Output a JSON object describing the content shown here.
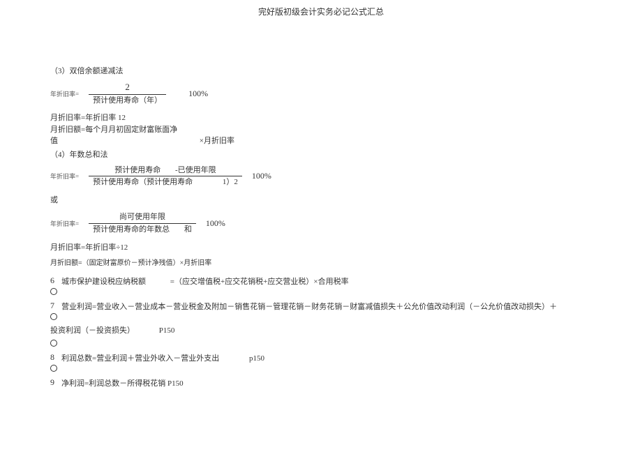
{
  "title": "完好版初级会计实务必记公式汇总",
  "sections": {
    "s3_head": "（3）双倍余额递减法",
    "s3_formula_label": "年折旧率=",
    "s3_num": "2",
    "s3_den": "预计使用寿命（年）",
    "s3_pct": "100%",
    "s3_line1": "月折旧率=年折旧率 12",
    "s3_line2a": "月折旧额=每个月月初固定财富账面净",
    "s3_line2b": "值",
    "s3_line2c": "×月折旧率",
    "s4_head": "（4）年数总和法",
    "s4_formula_label": "年折旧率=",
    "s4a_num_left": "预计使用寿命",
    "s4a_num_right": "-已使用年限",
    "s4a_den_left": "预计使用寿命（预计使用寿命",
    "s4a_den_right": "1）2",
    "s4a_pct": "100%",
    "or_word": "或",
    "s4b_label": "年折旧率=",
    "s4b_num": "尚可使用年限",
    "s4b_den_left": "预计使用寿命的年数总",
    "s4b_den_right": "和",
    "s4b_pct": "100%",
    "s4_line1": "月折旧率=年折旧率÷12",
    "s4_line2": "月折旧额=（固定财富原价－预计净残值）×月折旧率",
    "n6_num": "6",
    "n6_text_a": "城市保护建设税应纳税额",
    "n6_text_b": "=（应交增值税+应交花销税+应交营业税）×合用税率",
    "n7_num": "7",
    "n7_text": "营业利润=营业收入－营业成本－营业税金及附加－销售花销－管理花销－财务花销－财富减值损失＋公允价值改动利润（－公允价值改动损失）＋",
    "n7_text2_a": "投资利润（－投资损失）",
    "n7_text2_b": "P150",
    "n8_num": "8",
    "n8_text_a": "利润总数=营业利润＋营业外收入－营业外支出",
    "n8_text_b": "p150",
    "n9_num": "9",
    "n9_text": "净利润=利润总数－所得税花销 P150"
  }
}
